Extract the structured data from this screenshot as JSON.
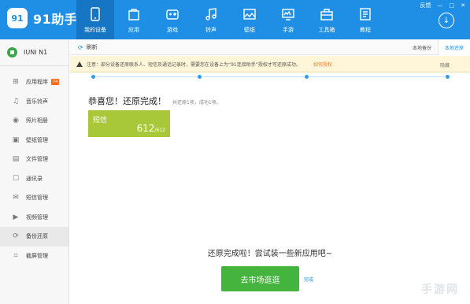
{
  "app": {
    "logo_badge": "91",
    "name": "91助手",
    "window_controls": [
      "反馈",
      "—",
      "□",
      "✕"
    ]
  },
  "nav": [
    {
      "label": "我的设备",
      "icon": "phone-icon",
      "active": true
    },
    {
      "label": "应用",
      "icon": "apps-icon"
    },
    {
      "label": "游戏",
      "icon": "gamepad-icon"
    },
    {
      "label": "铃声",
      "icon": "music-icon"
    },
    {
      "label": "壁纸",
      "icon": "image-icon"
    },
    {
      "label": "手游",
      "icon": "tv-icon"
    },
    {
      "label": "工具箱",
      "icon": "toolbox-icon"
    },
    {
      "label": "教程",
      "icon": "book-icon"
    }
  ],
  "device": {
    "name": "IUNI N1"
  },
  "sidebar": [
    {
      "label": "应用程序",
      "icon": "apps-icon",
      "badge": "74"
    },
    {
      "label": "音乐铃声",
      "icon": "music-icon"
    },
    {
      "label": "照片相册",
      "icon": "camera-icon"
    },
    {
      "label": "壁纸管理",
      "icon": "wallpaper-icon"
    },
    {
      "label": "文件管理",
      "icon": "file-icon"
    },
    {
      "label": "通讯录",
      "icon": "contacts-icon"
    },
    {
      "label": "短信管理",
      "icon": "sms-icon"
    },
    {
      "label": "视频管理",
      "icon": "video-icon"
    },
    {
      "label": "备份还原",
      "icon": "backup-icon",
      "active": true
    },
    {
      "label": "截屏管理",
      "icon": "crop-icon"
    }
  ],
  "toolbar": {
    "refresh_label": "刷新",
    "tabs": [
      "本地备份",
      "本地还原"
    ]
  },
  "notice": {
    "text": "注意：部分设备还原联系人、短信及通话记录时，需要您在设备上为“91连接助手”授权才可还原成功。",
    "link": "如何授权",
    "close_label": "隐藏"
  },
  "result": {
    "title": "恭喜您！还原完成！",
    "summary": "共还原1项，成功1项。",
    "tile_name": "短信",
    "tile_count": "612",
    "tile_total": "/612"
  },
  "footer": {
    "message": "还原完成啦！尝试装一些新应用吧~",
    "market_button": "去市场逛逛",
    "finish_link": "完成"
  },
  "watermark": "手游网",
  "colors": {
    "topbar": "#1f8fe6",
    "tile": "#a8c83a",
    "market_button": "#45b43f",
    "notice_bg": "#fff6d9",
    "notice_link": "#ff7a1a"
  }
}
